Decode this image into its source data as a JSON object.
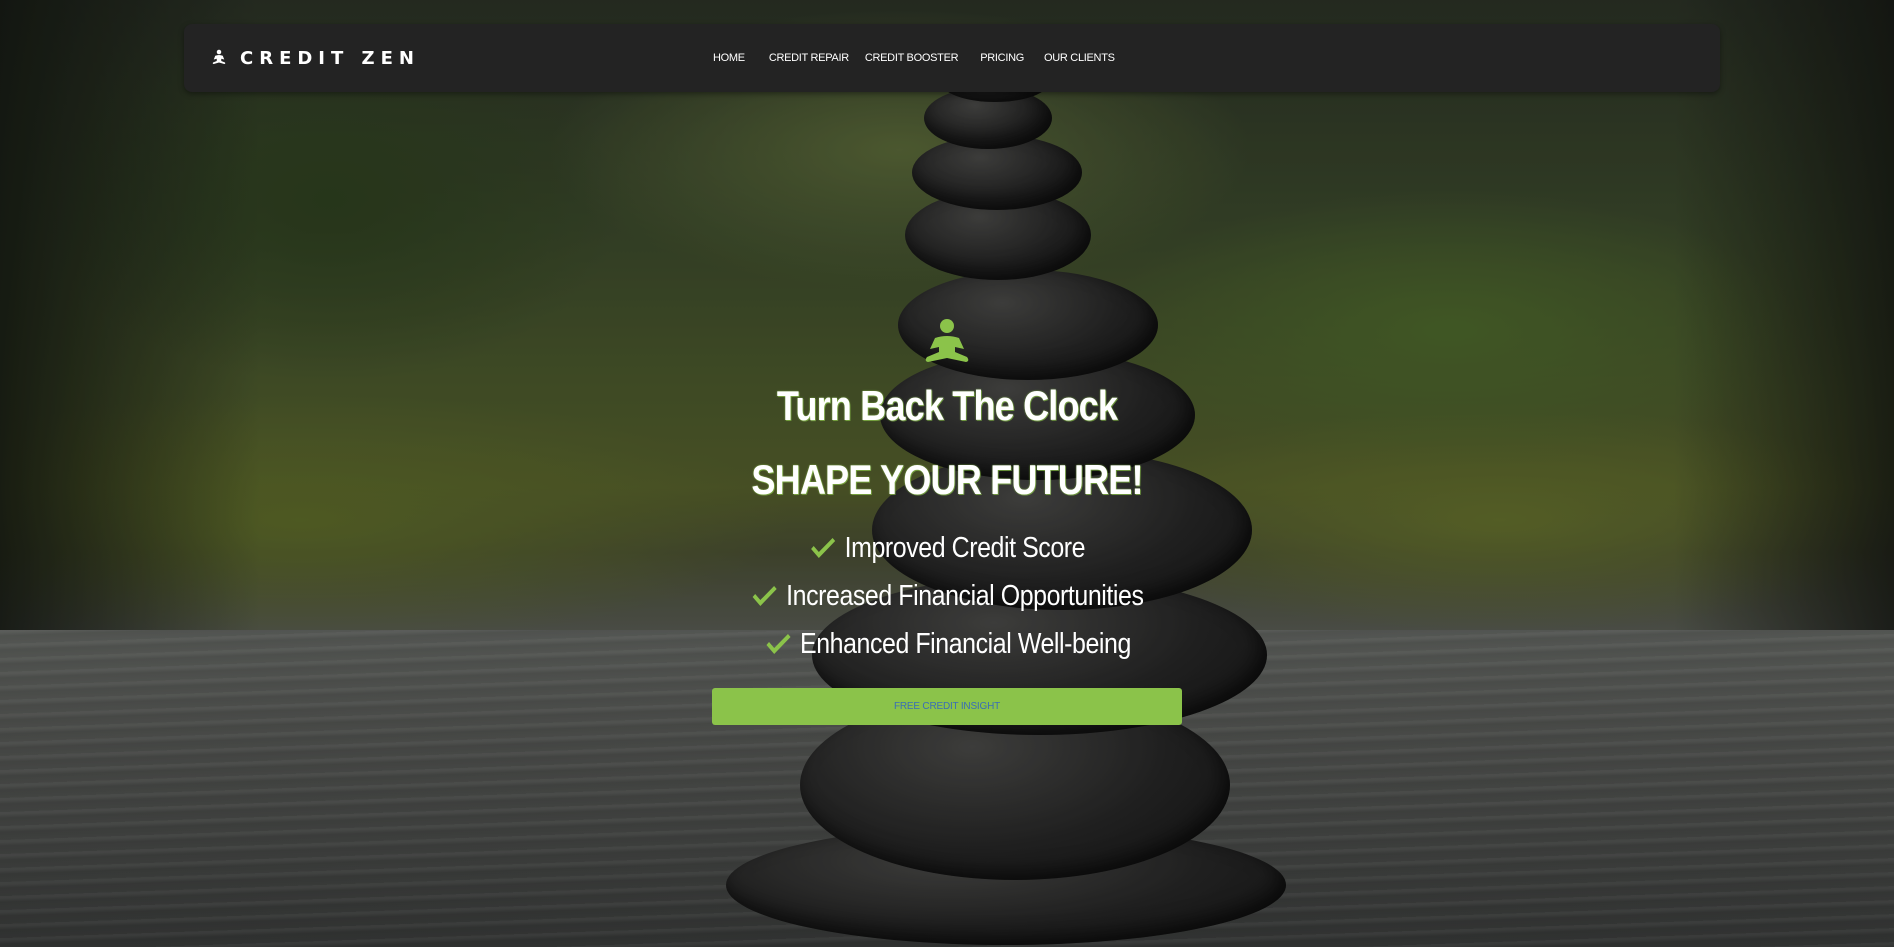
{
  "nav": {
    "brand": "CREDIT ZEN",
    "brand_icon": "meditation-icon",
    "links": {
      "home": "HOME",
      "credit_repair": "CREDIT REPAIR",
      "credit_booster": "CREDIT BOOSTER",
      "pricing": "PRICING",
      "our_clients": "OUR CLIENTS"
    }
  },
  "hero": {
    "icon": "meditation-icon",
    "title": "Turn Back The Clock",
    "subtitle": "SHAPE YOUR FUTURE!",
    "benefits": [
      "Improved Credit Score",
      "Increased Financial Opportunities",
      "Enhanced Financial Well-being"
    ],
    "benefit_icon": "check-icon",
    "cta_label": "FREE CREDIT INSIGHT"
  },
  "colors": {
    "accent": "#8bc34a",
    "nav_background": "#232323",
    "cta_text": "#3a6fb4"
  }
}
